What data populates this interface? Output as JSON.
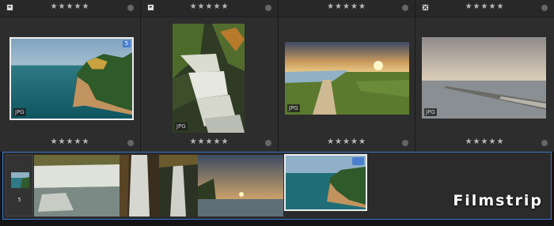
{
  "grid": {
    "cells": [
      {
        "stars": "★★★★★",
        "badge": "JPG",
        "tag": "5",
        "flag": "flag-white-icon"
      },
      {
        "stars": "★★★★★",
        "badge": "JPG",
        "flag": "flag-white-icon"
      },
      {
        "stars": "★★★★★",
        "badge": "JPG",
        "flag": "none"
      },
      {
        "stars": "★★★★★",
        "badge": "JPG",
        "flag": "flag-reject-icon"
      }
    ],
    "bottom_stars": [
      "★★★★★",
      "★★★★★",
      "★★★★★",
      "★★★★★"
    ]
  },
  "filmstrip": {
    "stack_count": "5",
    "title": "Filmstrip"
  },
  "colors": {
    "selection": "#3a75c9",
    "badge": "#4a7fd0"
  }
}
